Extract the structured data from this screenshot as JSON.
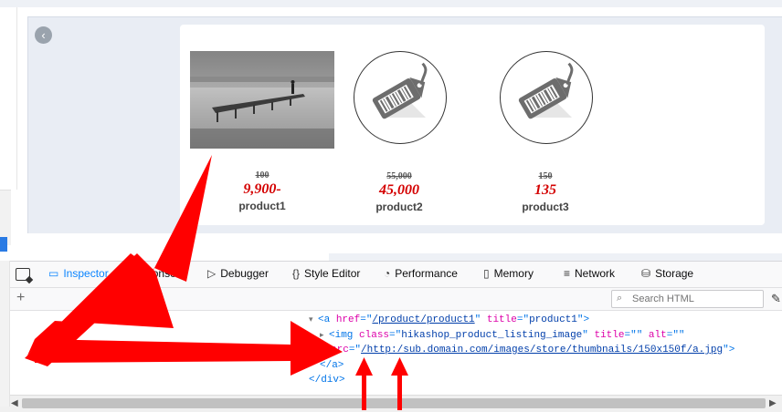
{
  "products": [
    {
      "name": "product1",
      "old_price": "100",
      "new_price": "9,900-",
      "image": "pier-landscape-photo"
    },
    {
      "name": "product2",
      "old_price": "55,000",
      "new_price": "45,000",
      "image": "price-tag-icon"
    },
    {
      "name": "product3",
      "old_price": "150",
      "new_price": "135",
      "image": "price-tag-icon"
    }
  ],
  "devtools": {
    "tabs": [
      {
        "label": "Inspector",
        "icon": "inspector-icon",
        "active": true
      },
      {
        "label": "Console",
        "icon": "console-icon"
      },
      {
        "label": "Debugger",
        "icon": "debugger-icon"
      },
      {
        "label": "Style Editor",
        "icon": "style-editor-icon"
      },
      {
        "label": "Performance",
        "icon": "performance-icon"
      },
      {
        "label": "Memory",
        "icon": "memory-icon"
      },
      {
        "label": "Network",
        "icon": "network-icon"
      },
      {
        "label": "Storage",
        "icon": "storage-icon"
      }
    ],
    "search_placeholder": "Search HTML",
    "markup": {
      "line1": {
        "tag_open": "<a ",
        "attr1": "href",
        "eq1": "=\"",
        "val1": "/product/product1",
        "q1": "\" ",
        "attr2": "title",
        "eq2": "=\"",
        "val2": "product1",
        "tag_close": "\">"
      },
      "line2": {
        "tag_open": "<img ",
        "attr1": "class",
        "eq1": "=\"",
        "val1": "hikashop_product_listing_image",
        "q1": "\" ",
        "attr2": "title",
        "eq2": "=\"\" ",
        "attr3": "alt",
        "eq3": "=\"\""
      },
      "line3": {
        "attr": "src",
        "eq": "=\"",
        "val": "/http:/sub.domain.com/images/store/thumbnails/150x150f/a.jpg",
        "tag_close": "\">"
      },
      "line4": {
        "text": "</a>"
      },
      "line5": {
        "text": "</div>"
      }
    }
  },
  "colors": {
    "annotation_red": "#ff0000",
    "price_red": "#d40000",
    "active_tab": "#0a84ff"
  }
}
